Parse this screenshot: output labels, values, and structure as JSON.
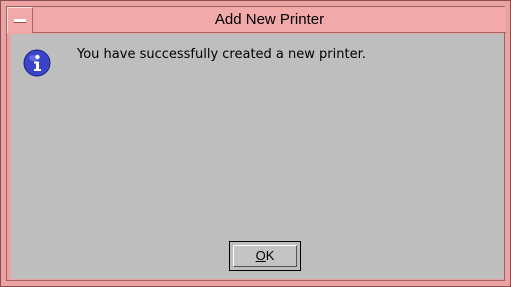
{
  "window": {
    "title": "Add New Printer"
  },
  "dialog": {
    "icon": "info-icon",
    "message": "You have successfully created a new printer.",
    "ok_mnemonic": "O",
    "ok_rest": "K"
  },
  "colors": {
    "titlebar": "#f1a9a9",
    "client": "#bebebe",
    "icon_blue": "#3a44c8"
  }
}
